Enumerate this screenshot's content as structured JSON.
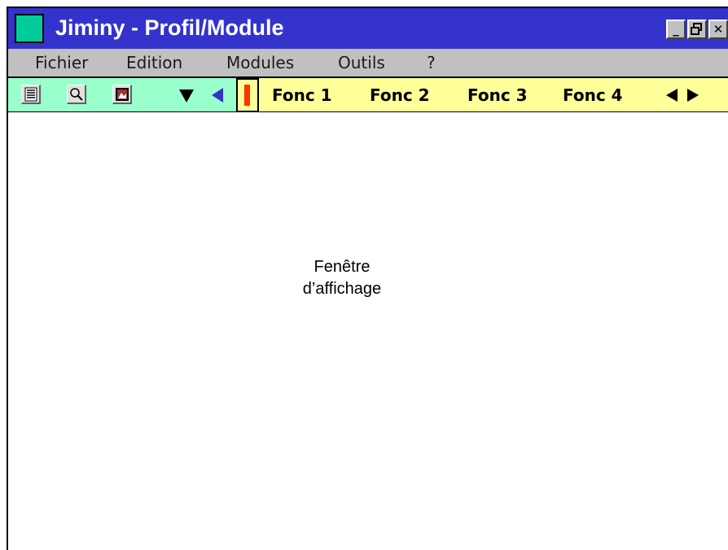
{
  "window": {
    "title": "Jiminy - Profil/Module",
    "app_icon": "teal-square-icon",
    "controls": {
      "minimize": "_",
      "maximize": "🗗",
      "close": "✕"
    },
    "colors": {
      "titlebar": "#3333cc",
      "menubar": "#c0c0c0",
      "toolbar_left": "#99ffcc",
      "toolbar_right": "#ffff99",
      "splitter": "#ff3300"
    }
  },
  "menu": {
    "items": [
      "Fichier",
      "Edition",
      "Modules",
      "Outils",
      "?"
    ]
  },
  "toolbar": {
    "tools": [
      {
        "icon": "list-icon"
      },
      {
        "icon": "magnifier-icon"
      },
      {
        "icon": "picture-icon"
      }
    ],
    "nav_down_icon": "triangle-down-icon",
    "nav_left_icon": "triangle-left-blue-icon"
  },
  "functions": {
    "items": [
      "Fonc 1",
      "Fonc 2",
      "Fonc 3",
      "Fonc 4"
    ],
    "scroll_left_icon": "arrow-left-icon",
    "scroll_right_icon": "arrow-right-icon"
  },
  "display": {
    "line1": "Fenêtre",
    "line2": "d’affichage"
  }
}
